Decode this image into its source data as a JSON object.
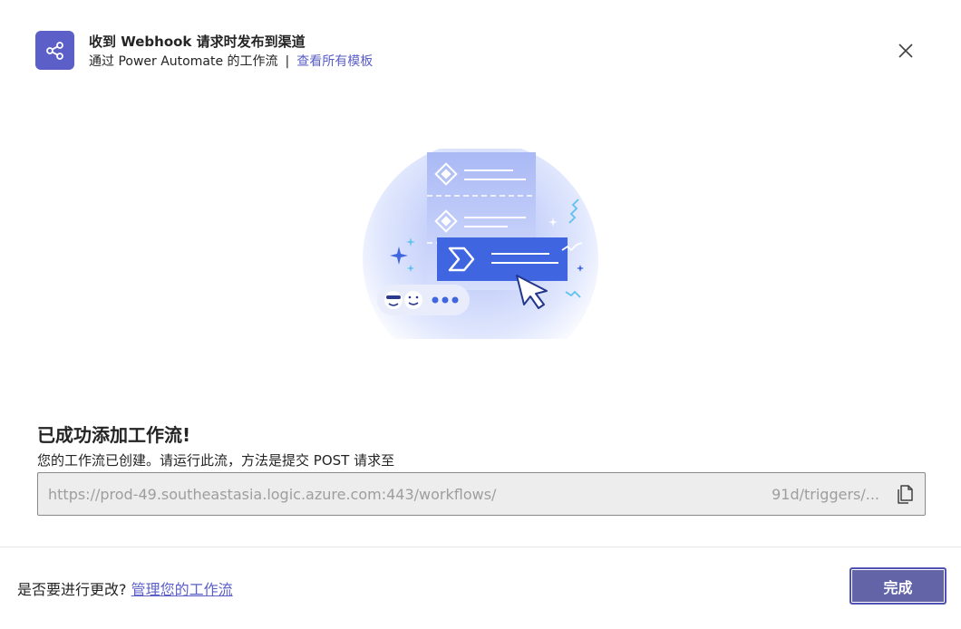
{
  "header": {
    "title": "收到 Webhook 请求时发布到渠道",
    "subtitle": "通过 Power Automate 的工作流",
    "separator": "|",
    "templates_link": "查看所有模板"
  },
  "main": {
    "success_title": "已成功添加工作流!",
    "success_desc": "您的工作流已创建。请运行此流，方法是提交 POST 请求至",
    "url_start": "https://prod-49.southeastasia.logic.azure.com:443/workflows/",
    "url_end": "91d/triggers/..."
  },
  "footer": {
    "question": "是否要进行更改?",
    "manage_link": "管理您的工作流",
    "done_label": "完成"
  },
  "icons": {
    "app": "share-nodes-icon",
    "close": "close-icon",
    "copy": "copy-icon"
  },
  "colors": {
    "accent": "#5b5fc7",
    "button": "#6264a7"
  }
}
